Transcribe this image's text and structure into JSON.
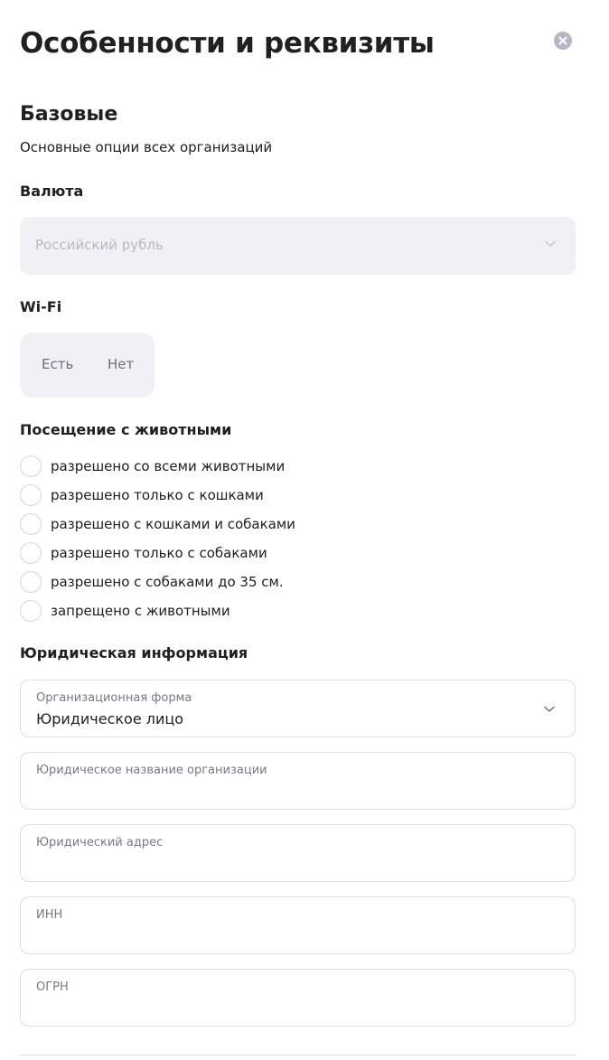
{
  "dialog": {
    "title": "Особенности и реквизиты",
    "close_icon": "close-circle-icon"
  },
  "basic": {
    "title": "Базовые",
    "description": "Основные опции всех организаций"
  },
  "currency": {
    "label": "Валюта",
    "value": "Российский рубль",
    "disabled": true
  },
  "wifi": {
    "label": "Wi-Fi",
    "options": [
      "Есть",
      "Нет"
    ]
  },
  "pets": {
    "label": "Посещение с животными",
    "options": [
      "разрешено со всеми животными",
      "разрешено только с кошками",
      "разрешено с кошками и собаками",
      "разрешено только с собаками",
      "разрешено с собаками до 35 см.",
      "запрещено с животными"
    ]
  },
  "legal": {
    "title": "Юридическая информация",
    "org_form": {
      "label": "Организационная форма",
      "value": "Юридическое лицо"
    },
    "legal_name": {
      "label": "Юридическое название организации"
    },
    "legal_address": {
      "label": "Юридический адрес"
    },
    "inn": {
      "label": "ИНН"
    },
    "ogrn": {
      "label": "ОГРН"
    }
  },
  "colors": {
    "text": "#21201f",
    "muted": "#767a87",
    "control_bg": "#f0f1f5",
    "border": "#dcdee4",
    "close_bg": "#b5b8c4"
  }
}
